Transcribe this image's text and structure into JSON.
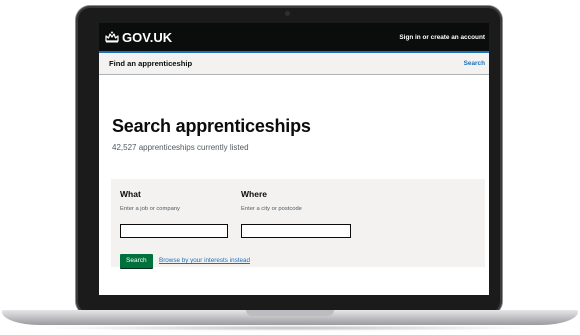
{
  "header": {
    "brand": "GOV.UK",
    "sign_in": "Sign in or create an account"
  },
  "service_bar": {
    "name": "Find an apprenticeship",
    "search_link": "Search"
  },
  "main": {
    "title": "Search apprenticeships",
    "count_text": "42,527 apprenticeships currently listed"
  },
  "search": {
    "what_label": "What",
    "what_hint": "Enter a job or company",
    "what_value": "",
    "where_label": "Where",
    "where_hint": "Enter a city or postcode",
    "where_value": "",
    "button_label": "Search",
    "browse_link": "Browse by your interests instead"
  },
  "colors": {
    "header_bg": "#0b0c0c",
    "link_blue": "#1d70b8",
    "button_green": "#00703c",
    "panel_grey": "#f3f2f1"
  },
  "icons": [
    "crown-icon"
  ]
}
